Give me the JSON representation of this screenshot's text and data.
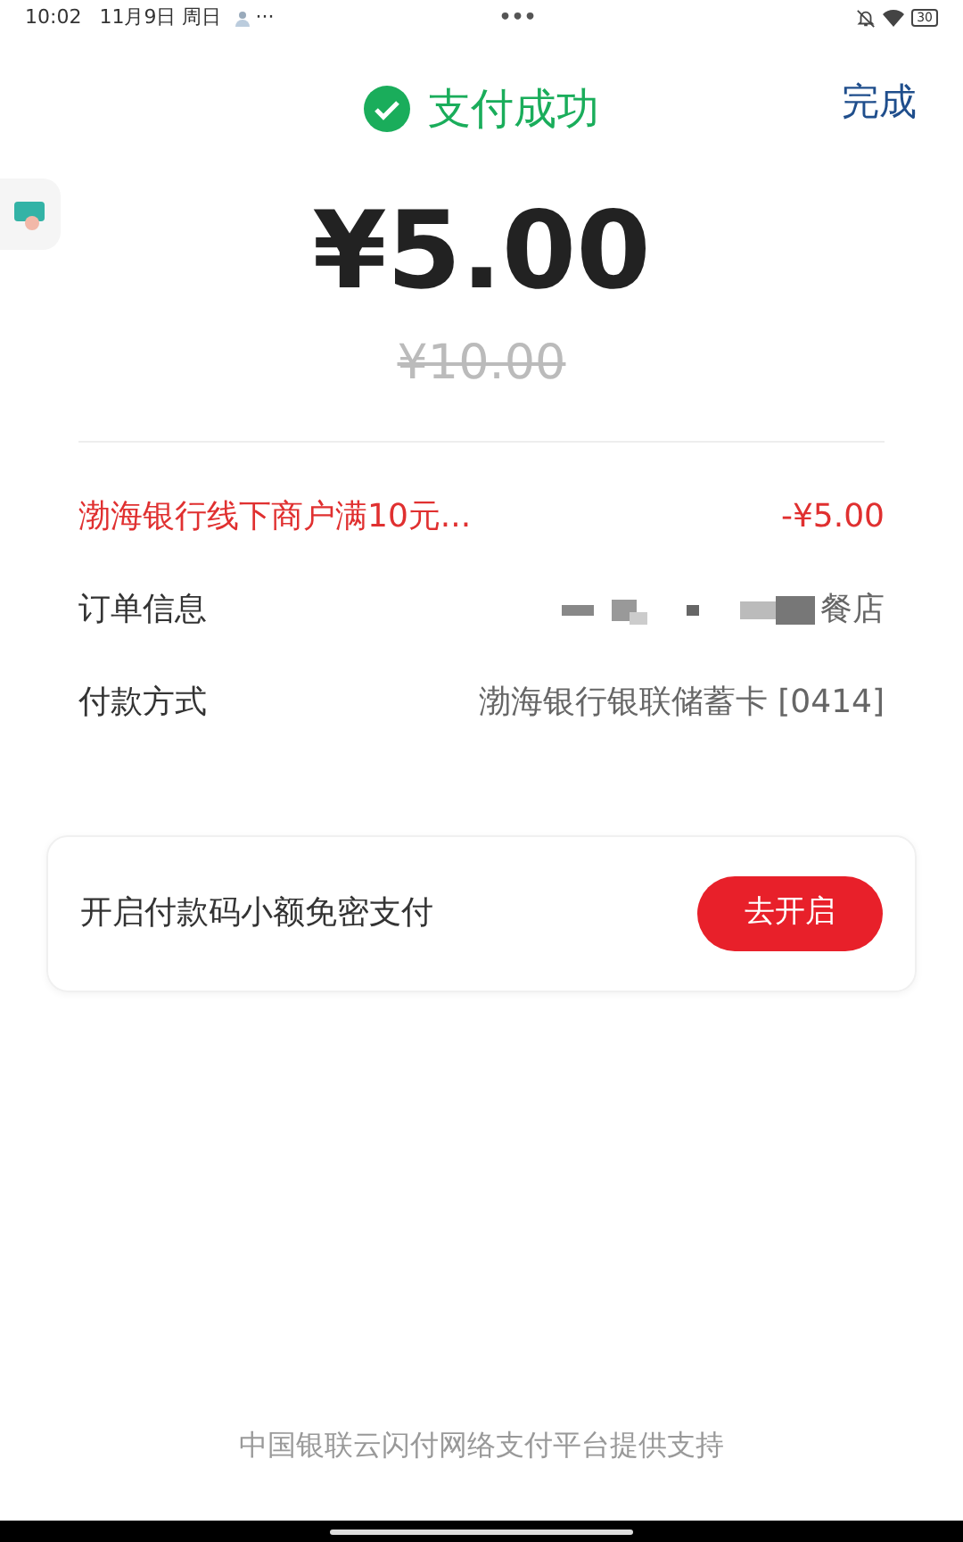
{
  "status_bar": {
    "time": "10:02",
    "date": "11月9日 周日",
    "more": "···",
    "center": "•••",
    "battery": "30"
  },
  "header": {
    "title": "支付成功",
    "done": "完成"
  },
  "amount": {
    "paid": "¥5.00",
    "original": "¥10.00"
  },
  "rows": [
    {
      "kind": "discount",
      "label": "渤海银行线下商户满10元...",
      "value": "-¥5.00"
    },
    {
      "kind": "redacted",
      "label": "订单信息",
      "value": "餐店"
    },
    {
      "kind": "plain",
      "label": "付款方式",
      "value": "渤海银行银联储蓄卡 [0414]"
    }
  ],
  "promo": {
    "text": "开启付款码小额免密支付",
    "button": "去开启"
  },
  "footer": "中国银联云闪付网络支付平台提供支持"
}
